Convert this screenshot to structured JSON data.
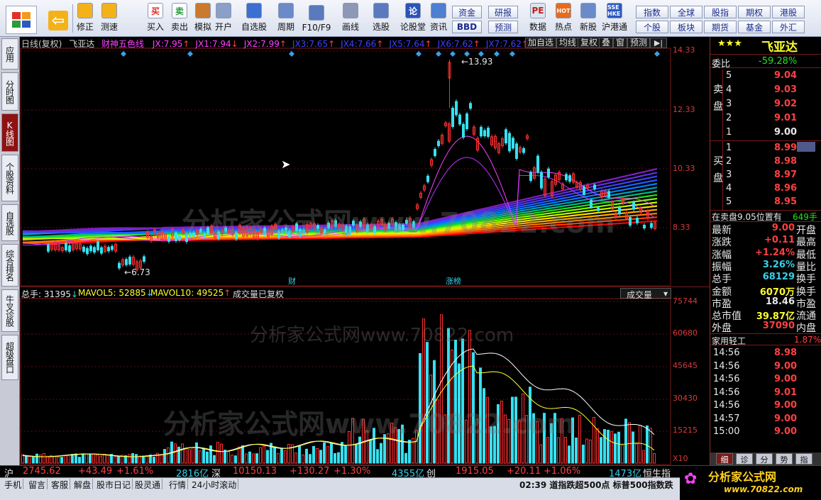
{
  "toolbar": {
    "buttons": [
      {
        "label": "修正",
        "icon": "up-down-arrow-icon"
      },
      {
        "label": "测速",
        "icon": "clock-icon"
      },
      {
        "label": "买入",
        "icon": "buy-icon",
        "glyph": "买"
      },
      {
        "label": "卖出",
        "icon": "sell-icon",
        "glyph": "卖"
      },
      {
        "label": "模拟",
        "icon": "hammer-icon"
      },
      {
        "label": "开户",
        "icon": "lock-icon"
      },
      {
        "label": "自选股",
        "icon": "star-icon"
      },
      {
        "label": "周期",
        "icon": "period-icon"
      },
      {
        "label": "F10/F9",
        "icon": "f10-icon"
      },
      {
        "label": "画线",
        "icon": "pencil-icon"
      },
      {
        "label": "选股",
        "icon": "select-stock-icon"
      },
      {
        "label": "论股堂",
        "icon": "forum-icon",
        "glyph": "论"
      },
      {
        "label": "资讯",
        "icon": "news-icon"
      },
      {
        "label": "数据",
        "icon": "data-icon",
        "glyph": "PE"
      },
      {
        "label": "热点",
        "icon": "hot-icon",
        "glyph": "HOT"
      },
      {
        "label": "新股",
        "icon": "new-stock-icon"
      },
      {
        "label": "沪港通",
        "icon": "hk-connect-icon",
        "glyph": "SSE HKE"
      }
    ],
    "small_buttons": {
      "zijin": "资金",
      "yanbao": "研报",
      "bbd": "BBD",
      "yuce": "预测",
      "zhishu": "指数",
      "quanqiu": "全球",
      "gaipiao": "股指",
      "qiquan": "期权",
      "ganggu": "港股",
      "gegu": "个股",
      "bankuai": "板块",
      "qihuo": "期货",
      "jijin": "基金",
      "waihui": "外汇"
    }
  },
  "left_tabs": [
    "应用",
    "分时图",
    "K线图",
    "个股资料",
    "自选股",
    "综合排名",
    "牛叉诊股",
    "超级盘口"
  ],
  "chart": {
    "title": "日线(复权)",
    "stock_name": "飞亚达",
    "indicator": "财神五色线",
    "jx": [
      {
        "label": "JX:",
        "value": "7.95",
        "color": "#ff40ff"
      },
      {
        "label": "JX1:",
        "value": "7.94",
        "color": "#ff40ff"
      },
      {
        "label": "JX2:",
        "value": "7.99",
        "color": "#ff40ff"
      },
      {
        "label": "JX3:",
        "value": "7.65",
        "color": "#4040ff"
      },
      {
        "label": "JX4:",
        "value": "7.66",
        "color": "#4040ff"
      },
      {
        "label": "JX5:",
        "value": "7.64",
        "color": "#4040ff"
      },
      {
        "label": "JX6:",
        "value": "7.62",
        "color": "#4040ff"
      },
      {
        "label": "JX7:",
        "value": "7.62",
        "color": "#4040ff"
      },
      {
        "label": "JX8",
        "value": "",
        "color": "#40ff40"
      }
    ],
    "menu": [
      "加自选",
      "均线",
      "复权",
      "叠",
      "窗",
      "预测"
    ],
    "price_axis": [
      "14.33",
      "12.33",
      "10.33",
      "8.33"
    ],
    "high_label": "13.93",
    "low_label": "6.73",
    "events": [
      "财",
      "涨榜"
    ],
    "volume_header": {
      "total": "总手: 31395",
      "ma5": "MAVOL5: 52885",
      "ma10": "MAVOL10: 49525",
      "note": "成交量已复权"
    },
    "volume_selector": "成交量",
    "volume_axis": [
      "75744",
      "60680",
      "45645",
      "30430",
      "15215"
    ],
    "volume_unit": "X10",
    "watermarks": [
      "分析家公式网www.70822.com",
      "分析家公式网www.70822.com",
      "分析家公式网www.70822.com"
    ]
  },
  "quote": {
    "stars": "★★★",
    "name": "飞亚达",
    "wei_bi_label": "委比",
    "wei_bi": "-59.28%",
    "sell_label": "卖盘",
    "buy_label": "买盘",
    "sells": [
      {
        "n": "5",
        "price": "9.04"
      },
      {
        "n": "4",
        "price": "9.03"
      },
      {
        "n": "3",
        "price": "9.02"
      },
      {
        "n": "2",
        "price": "9.01"
      },
      {
        "n": "1",
        "price": "9.00"
      }
    ],
    "buys": [
      {
        "n": "1",
        "price": "8.99"
      },
      {
        "n": "2",
        "price": "8.98"
      },
      {
        "n": "3",
        "price": "8.97"
      },
      {
        "n": "4",
        "price": "8.96"
      },
      {
        "n": "5",
        "price": "8.95"
      }
    ],
    "position_note": "在卖盘9.05位置有",
    "position_qty": "649手",
    "stats": [
      {
        "label": "最新",
        "value": "9.00",
        "right": "开盘",
        "color": "#ff4040"
      },
      {
        "label": "涨跌",
        "value": "+0.11",
        "right": "最高",
        "color": "#ff4040"
      },
      {
        "label": "涨幅",
        "value": "+1.24%",
        "right": "最低",
        "color": "#ff4040"
      },
      {
        "label": "振幅",
        "value": "3.26%",
        "right": "量比",
        "color": "#37d0e8"
      },
      {
        "label": "总手",
        "value": "68129",
        "right": "换手",
        "color": "#37d0e8"
      },
      {
        "label": "金额",
        "value": "6070万",
        "right": "换手",
        "color": "#ffff30"
      },
      {
        "label": "市盈",
        "value": "18.46",
        "right": "市盈",
        "color": "#e8e8e8"
      },
      {
        "label": "总市值",
        "value": "39.87亿",
        "right": "流通",
        "color": "#ffff30"
      },
      {
        "label": "外盘",
        "value": "37090",
        "right": "内盘",
        "color": "#ff4040"
      }
    ],
    "industry": "家用轻工",
    "industry_change": "1.87%",
    "ticks": [
      {
        "time": "14:56",
        "price": "8.98"
      },
      {
        "time": "14:56",
        "price": "9.00"
      },
      {
        "time": "14:56",
        "price": "9.00"
      },
      {
        "time": "14:56",
        "price": "9.01"
      },
      {
        "time": "14:56",
        "price": "9.00"
      },
      {
        "time": "14:57",
        "price": "9.00"
      },
      {
        "time": "15:00",
        "price": "9.00"
      }
    ],
    "bottom_tabs": [
      "细",
      "诊",
      "分",
      "势",
      "指"
    ]
  },
  "index_bar": {
    "sh_label": "沪",
    "sh_value": "2745.62",
    "sh_change": "+43.49",
    "sh_pct": "+1.61%",
    "sh_vol": "2816亿",
    "sz_label": "深",
    "sz_value": "10150.13",
    "sz_change": "+130.27",
    "sz_pct": "+1.30%",
    "sz_vol": "4355亿",
    "cy_label": "创",
    "cy_value": "1915.05",
    "cy_change": "+20.11",
    "cy_pct": "+1.06%",
    "cy_vol": "1473亿",
    "hs_label": "恒生指"
  },
  "status_bar": {
    "items": [
      "手机",
      "留言",
      "客服",
      "解盘",
      "股市日记",
      "股灵通",
      "行情",
      "24小时滚动"
    ],
    "ticker": "02:39 道指跌超500点 标普500指数跌",
    "brand": "分析家公式网",
    "brand_url": "www.70822.com"
  }
}
